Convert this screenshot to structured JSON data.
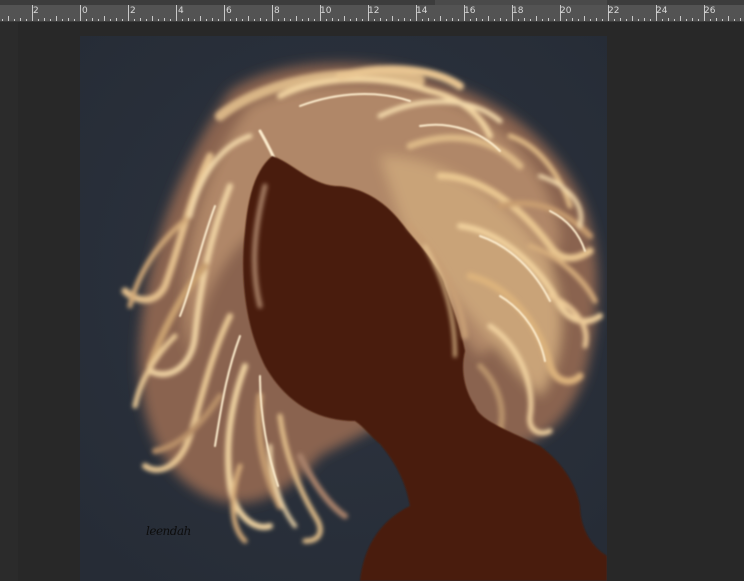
{
  "ruler": {
    "labels": [
      "2",
      "0",
      "2",
      "4",
      "6",
      "8",
      "10",
      "12",
      "14",
      "16",
      "18",
      "20",
      "22",
      "24",
      "26"
    ]
  },
  "artwork": {
    "signature": "leendah"
  },
  "colors": {
    "workspace": "#282828",
    "ruler": "#535353",
    "canvas_background": "#2a313c",
    "silhouette": "#4a1a08",
    "hair_light": "#f1d3a0",
    "hair_mid": "#c59a6e",
    "hair_shadow": "#6e4a3c"
  }
}
